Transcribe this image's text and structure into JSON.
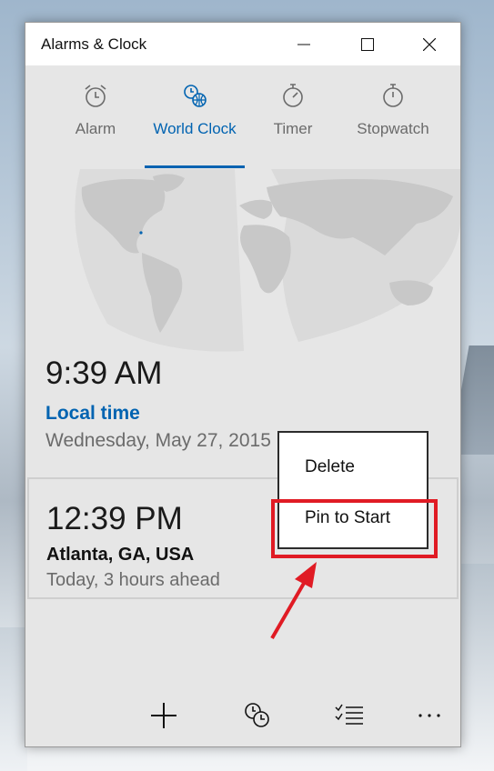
{
  "window": {
    "title": "Alarms & Clock"
  },
  "tabs": [
    {
      "label": "Alarm",
      "icon": "alarm-clock-icon"
    },
    {
      "label": "World Clock",
      "icon": "world-clock-icon",
      "active": true
    },
    {
      "label": "Timer",
      "icon": "timer-icon"
    },
    {
      "label": "Stopwatch",
      "icon": "stopwatch-icon"
    }
  ],
  "local_clock": {
    "time": "9:39 AM",
    "label": "Local time",
    "date": "Wednesday, May 27, 2015"
  },
  "world_clocks": [
    {
      "time": "12:39 PM",
      "city": "Atlanta, GA, USA",
      "offset": "Today, 3 hours ahead"
    }
  ],
  "context_menu": {
    "items": [
      {
        "label": "Delete"
      },
      {
        "label": "Pin to Start"
      }
    ]
  },
  "bottom_bar": {
    "icons": [
      "add-icon",
      "compare-clocks-icon",
      "select-icon",
      "more-icon"
    ]
  },
  "colors": {
    "accent": "#0063b1",
    "annotation": "#e01b24"
  }
}
